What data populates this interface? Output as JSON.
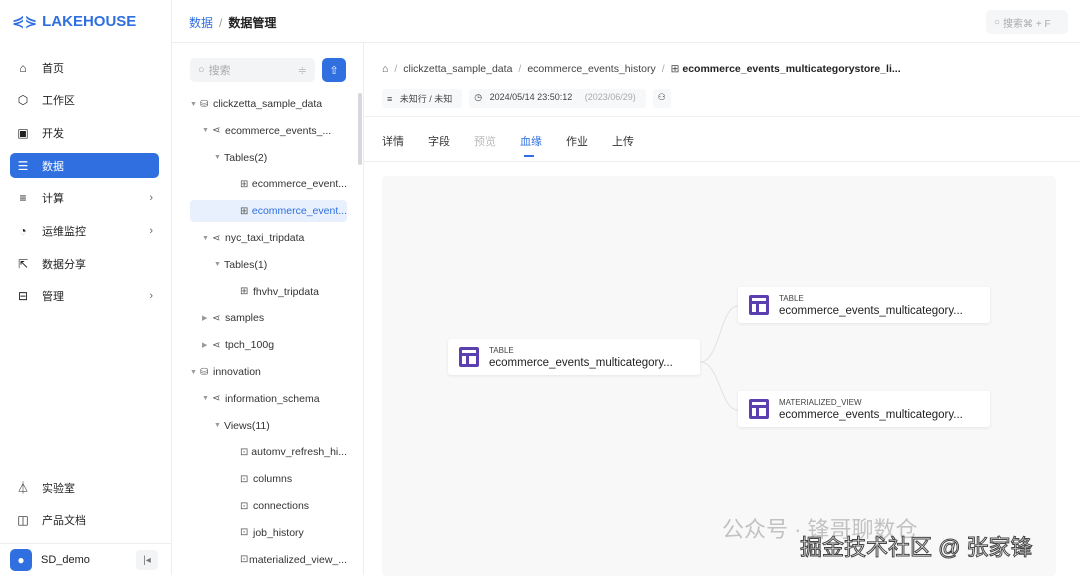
{
  "app": {
    "logo": "LAKEHOUSE"
  },
  "sidebar": {
    "items": [
      {
        "label": "首页",
        "icon": "home-icon"
      },
      {
        "label": "工作区",
        "icon": "cube-icon"
      },
      {
        "label": "开发",
        "icon": "terminal-icon"
      },
      {
        "label": "数据",
        "icon": "database-icon",
        "active": true
      },
      {
        "label": "计算",
        "icon": "compute-icon",
        "chevron": true
      },
      {
        "label": "运维监控",
        "icon": "monitor-icon",
        "chevron": true
      },
      {
        "label": "数据分享",
        "icon": "share-icon"
      },
      {
        "label": "管理",
        "icon": "server-icon",
        "chevron": true
      }
    ],
    "bottom": [
      {
        "label": "实验室",
        "icon": "flask-icon"
      },
      {
        "label": "产品文档",
        "icon": "book-icon"
      }
    ],
    "user": "SD_demo"
  },
  "header": {
    "breadcrumb": [
      "数据",
      "数据管理"
    ],
    "search_placeholder": "搜索⌘ + F"
  },
  "tree": {
    "search_placeholder": "搜索",
    "rows": [
      {
        "label": "clickzetta_sample_data",
        "depth": 0,
        "arrow": "▼",
        "icon": "database-icon"
      },
      {
        "label": "ecommerce_events_...",
        "depth": 1,
        "arrow": "▼",
        "icon": "schema-icon"
      },
      {
        "label": "Tables(2)",
        "depth": 2,
        "arrow": "▼",
        "icon": ""
      },
      {
        "label": "ecommerce_event...",
        "depth": 3,
        "arrow": "",
        "icon": "table-icon"
      },
      {
        "label": "ecommerce_event...",
        "depth": 3,
        "arrow": "",
        "icon": "table-icon",
        "selected": true
      },
      {
        "label": "nyc_taxi_tripdata",
        "depth": 1,
        "arrow": "▼",
        "icon": "schema-icon"
      },
      {
        "label": "Tables(1)",
        "depth": 2,
        "arrow": "▼",
        "icon": ""
      },
      {
        "label": "fhvhv_tripdata",
        "depth": 3,
        "arrow": "",
        "icon": "table-icon"
      },
      {
        "label": "samples",
        "depth": 1,
        "arrow": "▶",
        "icon": "schema-icon"
      },
      {
        "label": "tpch_100g",
        "depth": 1,
        "arrow": "▶",
        "icon": "schema-icon"
      },
      {
        "label": "innovation",
        "depth": 0,
        "arrow": "▼",
        "icon": "database-icon"
      },
      {
        "label": "information_schema",
        "depth": 1,
        "arrow": "▼",
        "icon": "schema-icon"
      },
      {
        "label": "Views(11)",
        "depth": 2,
        "arrow": "▼",
        "icon": ""
      },
      {
        "label": "automv_refresh_hi...",
        "depth": 3,
        "arrow": "",
        "icon": "view-icon"
      },
      {
        "label": "columns",
        "depth": 3,
        "arrow": "",
        "icon": "view-icon"
      },
      {
        "label": "connections",
        "depth": 3,
        "arrow": "",
        "icon": "view-icon"
      },
      {
        "label": "job_history",
        "depth": 3,
        "arrow": "",
        "icon": "view-icon"
      },
      {
        "label": "materialized_view_...",
        "depth": 3,
        "arrow": "",
        "icon": "view-icon"
      }
    ]
  },
  "main": {
    "path": [
      "clickzetta_sample_data",
      "ecommerce_events_history",
      "ecommerce_events_multicategorystore_li..."
    ],
    "meta": {
      "rows": "未知行 / 未知",
      "time": "2024/05/14 23:50:12",
      "date": "(2023/06/29)"
    },
    "tabs": [
      {
        "label": "详情"
      },
      {
        "label": "字段"
      },
      {
        "label": "预览",
        "disabled": true
      },
      {
        "label": "血缘",
        "active": true
      },
      {
        "label": "作业"
      },
      {
        "label": "上传"
      }
    ],
    "lineage": [
      {
        "type": "TABLE",
        "name": "ecommerce_events_multicategory..."
      },
      {
        "type": "TABLE",
        "name": "ecommerce_events_multicategory..."
      },
      {
        "type": "MATERIALIZED_VIEW",
        "name": "ecommerce_events_multicategory..."
      }
    ]
  },
  "watermark": {
    "line1": "公众号 · 锋哥聊数仓",
    "line2": "掘金技术社区 @ 张家锋"
  }
}
